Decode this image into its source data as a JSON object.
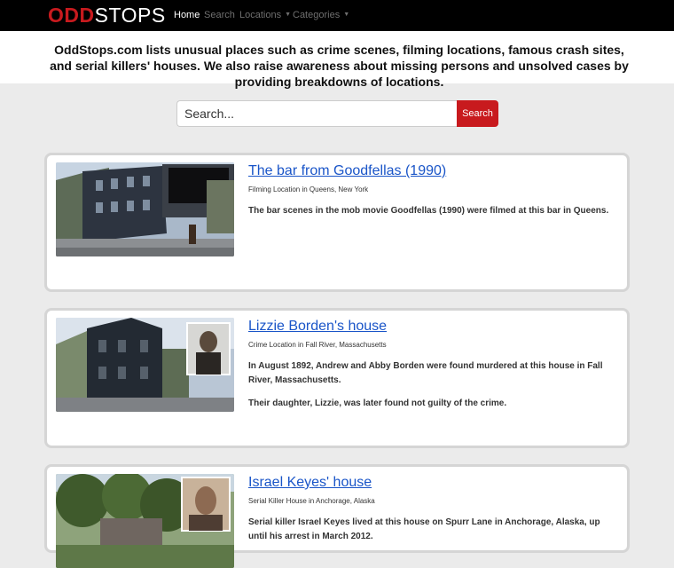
{
  "navbar": {
    "logo_part1": "ODD",
    "logo_part2": "STOPS",
    "links": [
      {
        "label": "Home",
        "active": true
      },
      {
        "label": "Search",
        "active": false
      },
      {
        "label": "Locations",
        "active": false
      },
      {
        "label": "Categories",
        "active": false
      }
    ]
  },
  "intro": {
    "text": "OddStops.com lists unusual places such as crime scenes, filming locations, famous crash sites, and serial killers' houses. We also raise awareness about missing persons and unsolved cases by providing breakdowns of locations."
  },
  "search": {
    "placeholder": "Search...",
    "button_label": "Search"
  },
  "cards": [
    {
      "title": "The bar from Goodfellas (1990)",
      "subtitle": "Filming Location in Queens, New York",
      "paragraphs": [
        "The bar scenes in the mob movie Goodfellas (1990) were filmed at this bar in Queens."
      ]
    },
    {
      "title": "Lizzie Borden's house",
      "subtitle": "Crime Location in Fall River, Massachusetts",
      "paragraphs": [
        "In August 1892, Andrew and Abby Borden were found murdered at this house in Fall River, Massachusetts.",
        "Their daughter, Lizzie, was later found not guilty of the crime."
      ]
    },
    {
      "title": "Israel Keyes' house",
      "subtitle": "Serial Killer House in Anchorage, Alaska",
      "paragraphs": [
        "Serial killer Israel Keyes lived at this house on Spurr Lane in Anchorage, Alaska, up until his arrest in March 2012."
      ]
    }
  ],
  "colors": {
    "brand_red": "#c81a1e",
    "link_blue": "#1a55c8",
    "page_background": "#ebebeb"
  }
}
